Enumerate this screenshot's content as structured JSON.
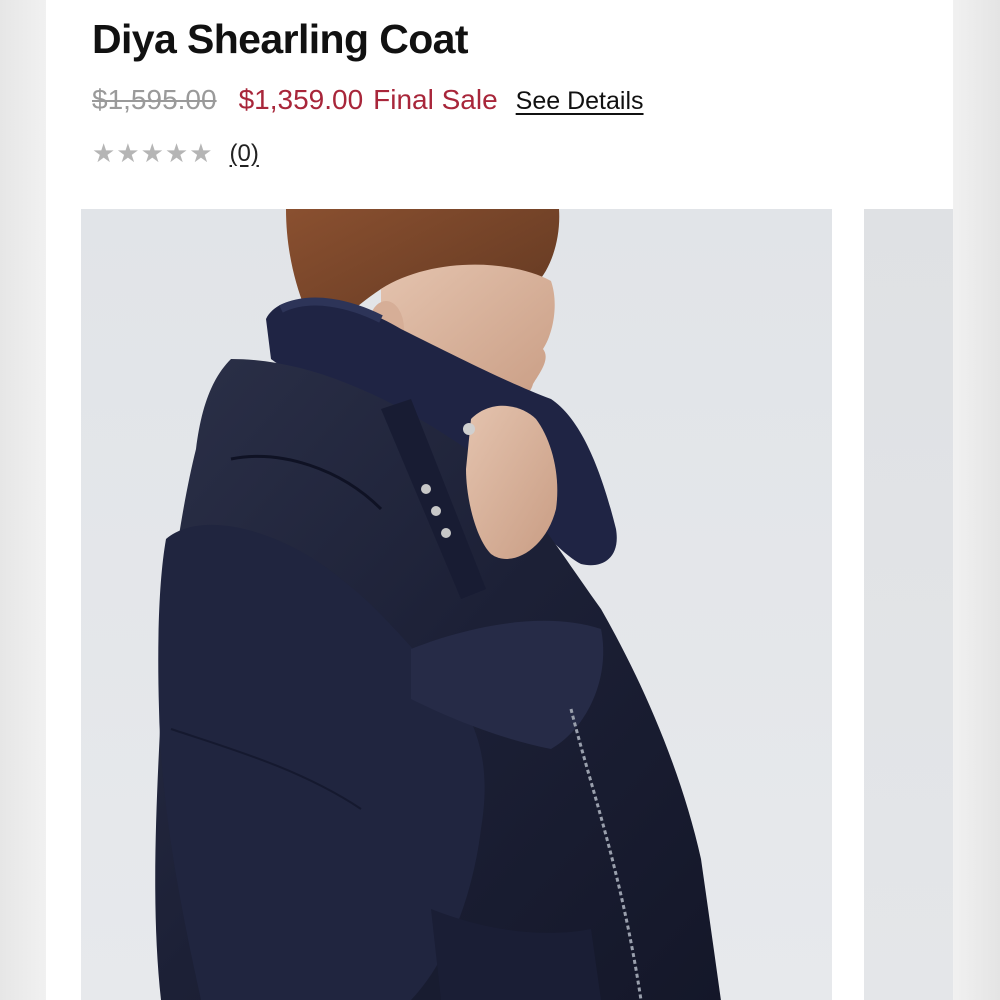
{
  "product": {
    "title": "Diya Shearling Coat",
    "original_price": "$1,595.00",
    "sale_price": "$1,359.00",
    "sale_label": "Final Sale",
    "details_link": "See Details",
    "rating_stars": "★★★★★",
    "rating_value": 0,
    "review_count": "(0)"
  },
  "colors": {
    "sale_red": "#a8263a",
    "strikethrough_gray": "#9a9a9a",
    "star_gray": "#b5b5b5"
  },
  "icons": {
    "rating": "star-icon"
  }
}
